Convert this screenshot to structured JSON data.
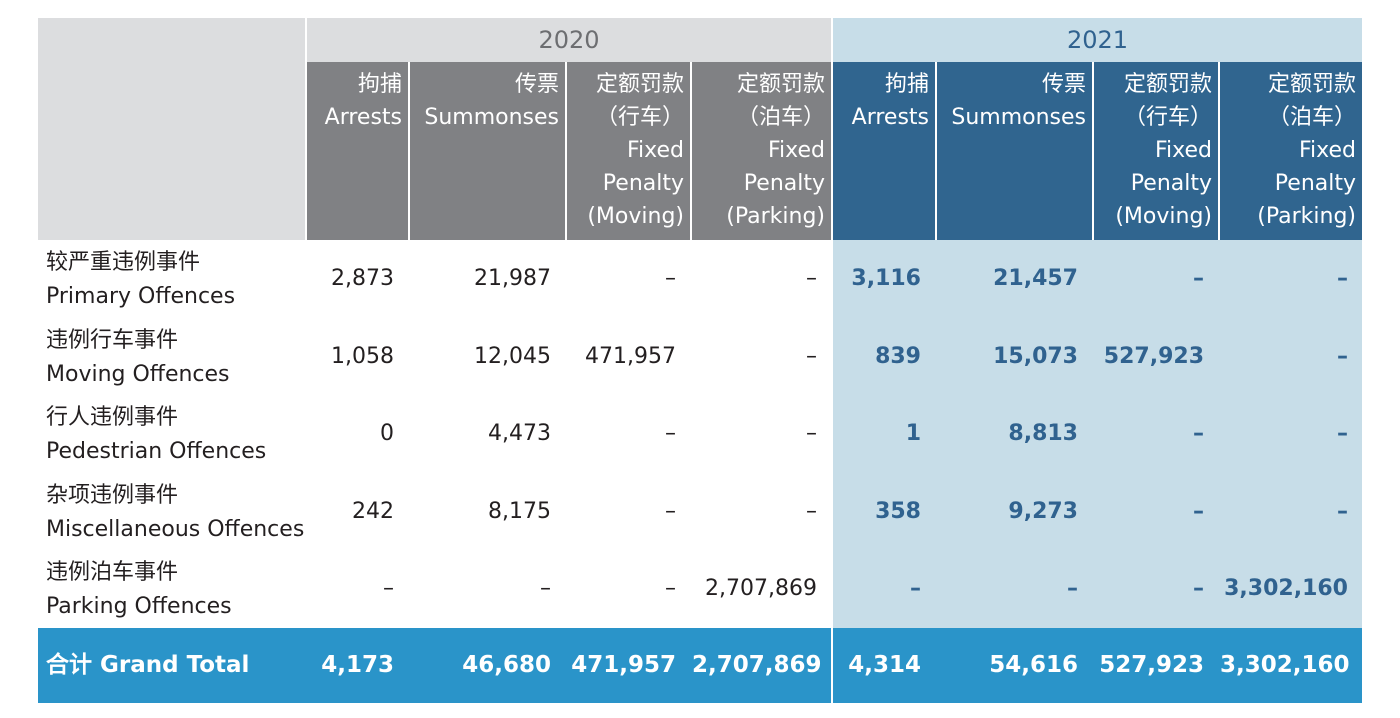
{
  "years": [
    "2020",
    "2021"
  ],
  "columns": [
    {
      "zh": "拘捕",
      "en": "Arrests"
    },
    {
      "zh": "传票",
      "en": "Summonses"
    },
    {
      "zh": "定额罚款\n（行车）",
      "en": "Fixed\nPenalty\n(Moving)"
    },
    {
      "zh": "定额罚款\n（泊车）",
      "en": "Fixed\nPenalty\n(Parking)"
    }
  ],
  "column_headers": [
    "拘捕\nArrests",
    "传票\nSummonses",
    "定额罚款\n（行车）\nFixed\nPenalty\n(Moving)",
    "定额罚款\n（泊车）\nFixed\nPenalty\n(Parking)"
  ],
  "rows": [
    {
      "zh": "较严重违例事件",
      "en": "Primary Offences",
      "v2020": [
        "2,873",
        "21,987",
        "–",
        "–"
      ],
      "v2021": [
        "3,116",
        "21,457",
        "–",
        "–"
      ]
    },
    {
      "zh": "违例行车事件",
      "en": "Moving Offences",
      "v2020": [
        "1,058",
        "12,045",
        "471,957",
        "–"
      ],
      "v2021": [
        "839",
        "15,073",
        "527,923",
        "–"
      ]
    },
    {
      "zh": "行人违例事件",
      "en": "Pedestrian Offences",
      "v2020": [
        "0",
        "4,473",
        "–",
        "–"
      ],
      "v2021": [
        "1",
        "8,813",
        "–",
        "–"
      ]
    },
    {
      "zh": "杂项违例事件",
      "en": "Miscellaneous Offences",
      "v2020": [
        "242",
        "8,175",
        "–",
        "–"
      ],
      "v2021": [
        "358",
        "9,273",
        "–",
        "–"
      ]
    },
    {
      "zh": "违例泊车事件",
      "en": "Parking Offences",
      "v2020": [
        "–",
        "–",
        "–",
        "2,707,869"
      ],
      "v2021": [
        "–",
        "–",
        "–",
        "3,302,160"
      ]
    }
  ],
  "total": {
    "label": "合计 Grand Total",
    "v2020": [
      "4,173",
      "46,680",
      "471,957",
      "2,707,869"
    ],
    "v2021": [
      "4,314",
      "54,616",
      "527,923",
      "3,302,160"
    ]
  },
  "colors": {
    "header_2020": "#808184",
    "header_2021": "#30658f",
    "year_band_2020": "#dcdddf",
    "year_band_2021": "#c7dde8",
    "total_row": "#2a94c9"
  }
}
